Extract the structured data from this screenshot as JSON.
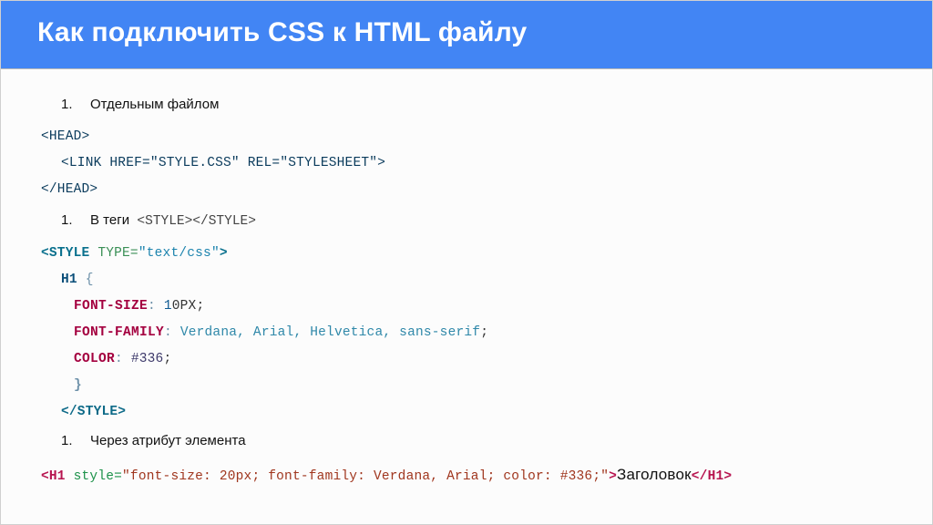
{
  "header": {
    "title": "Как подключить CSS к HTML файлу"
  },
  "list": {
    "num": "1.",
    "item1": "Отдельным файлом",
    "item2_prefix": "В теги",
    "item2_tag": "<STYLE></STYLE>",
    "item3": "Через атрибут элемента"
  },
  "snippet1": {
    "open": "<HEAD>",
    "link": "<LINK HREF=\"STYLE.CSS\" REL=\"STYLESHEET\">",
    "close": "</HEAD>"
  },
  "snippet2": {
    "open": {
      "lt": "<STYLE",
      "attr": " TYPE=",
      "val": "\"text/css\"",
      "gt": ">"
    },
    "selector": "H1",
    "brace_open": "{",
    "props": {
      "font_size": {
        "name": "FONT-SIZE",
        "colon": ":",
        "lead": " 1",
        "rest": "0",
        "unit": "PX",
        "semi": ";"
      },
      "font_family": {
        "name": "FONT-FAMILY",
        "colon": ":",
        "value": " Verdana, Arial, Helvetica, sans-serif",
        "semi": ";"
      },
      "color": {
        "name": "COLOR",
        "colon": ":",
        "value": " #336",
        "semi": ";"
      }
    },
    "brace_close": "}",
    "close": "</STYLE>"
  },
  "snippet3": {
    "open_lt": "<H1",
    "attr": " style=",
    "val": "\"font-size: 20px; font-family: Verdana, Arial; color: #336;\"",
    "gt": ">",
    "text": "Заголовок",
    "close": "</H1>"
  }
}
